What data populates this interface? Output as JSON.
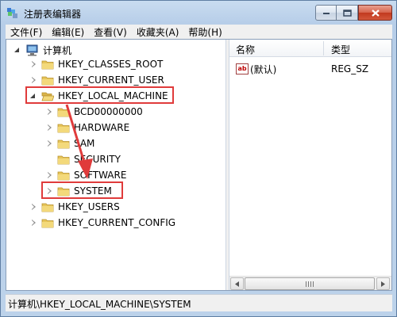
{
  "window": {
    "title": "注册表编辑器"
  },
  "menu": [
    {
      "label": "文件(F)"
    },
    {
      "label": "编辑(E)"
    },
    {
      "label": "查看(V)"
    },
    {
      "label": "收藏夹(A)"
    },
    {
      "label": "帮助(H)"
    }
  ],
  "tree": {
    "root": "计算机",
    "nodes": [
      {
        "label": "HKEY_CLASSES_ROOT"
      },
      {
        "label": "HKEY_CURRENT_USER"
      },
      {
        "label": "HKEY_LOCAL_MACHINE"
      },
      {
        "label": "BCD00000000"
      },
      {
        "label": "HARDWARE"
      },
      {
        "label": "SAM"
      },
      {
        "label": "SECURITY"
      },
      {
        "label": "SOFTWARE"
      },
      {
        "label": "SYSTEM"
      },
      {
        "label": "HKEY_USERS"
      },
      {
        "label": "HKEY_CURRENT_CONFIG"
      }
    ]
  },
  "list": {
    "headers": {
      "name": "名称",
      "type": "类型"
    },
    "rows": [
      {
        "name": "(默认)",
        "type": "REG_SZ"
      }
    ]
  },
  "status": {
    "path": "计算机\\HKEY_LOCAL_MACHINE\\SYSTEM"
  },
  "colors": {
    "highlight": "#e03b3b",
    "folder": "#e7c55a",
    "title_bg": "#c9dcf0"
  }
}
